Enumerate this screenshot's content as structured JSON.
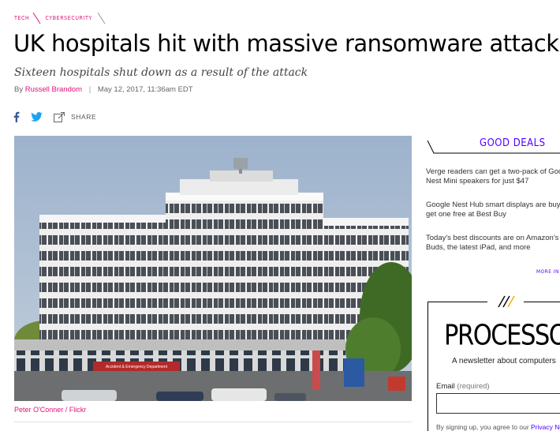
{
  "breadcrumb": {
    "section": "TECH",
    "subsection": "CYBERSECURITY"
  },
  "article": {
    "headline": "UK hospitals hit with massive ransomware attack",
    "dek": "Sixteen hospitals shut down as a result of the attack",
    "by_prefix": "By",
    "author": "Russell Brandom",
    "byline_separator": "|",
    "date": "May 12, 2017, 11:36am EDT",
    "photo_credit": "Peter O'Conner / Flickr",
    "signage_text": "Accident & Emergency Department"
  },
  "share": {
    "facebook_icon": "facebook-icon",
    "twitter_icon": "twitter-icon",
    "share_icon": "share-arrow-icon",
    "label": "SHARE"
  },
  "sidebar": {
    "deals_title": "GOOD DEALS",
    "deals": [
      {
        "text": "Verge readers can get a two-pack of Google Nest Mini speakers for just $47"
      },
      {
        "text": "Google Nest Hub smart displays are buy one, get one free at Best Buy"
      },
      {
        "text": "Today's best discounts are on Amazon's Echo Buds, the latest iPad, and more"
      }
    ],
    "more_link": "MORE IN GOOD DEALS",
    "newsletter": {
      "logo": "PROCESSOR",
      "subtitle": "A newsletter about computers",
      "email_label": "Email",
      "email_required": "(required)",
      "email_value": "",
      "legal_prefix": "By signing up, you agree to our ",
      "legal_link": "Privacy Notice"
    }
  },
  "colors": {
    "accent_pink": "#e2127a",
    "accent_purple": "#5200ff",
    "facebook_blue": "#3b5998",
    "twitter_blue": "#1da1f2"
  }
}
